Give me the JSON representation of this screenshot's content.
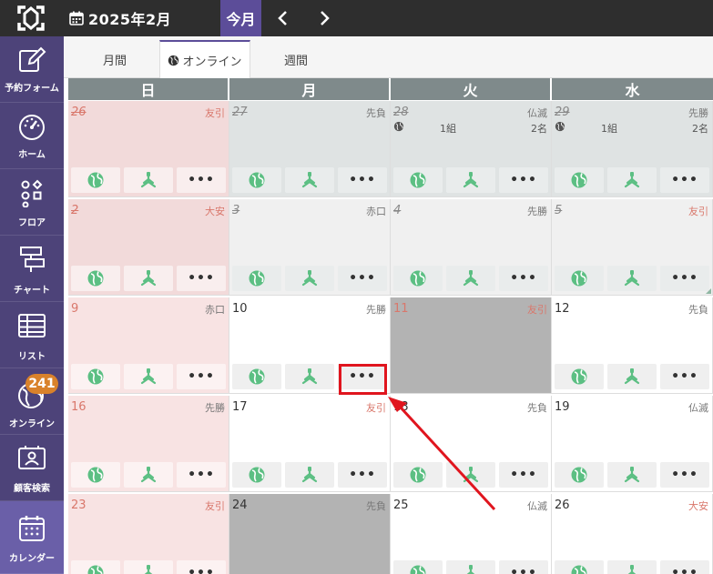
{
  "header": {
    "month": "2025年2月",
    "today_label": "今月"
  },
  "sidebar": {
    "items": [
      {
        "label": "予約フォーム",
        "icon": "edit-icon"
      },
      {
        "label": "ホーム",
        "icon": "dashboard-icon"
      },
      {
        "label": "フロア",
        "icon": "floor-icon"
      },
      {
        "label": "チャート",
        "icon": "chart-icon"
      },
      {
        "label": "リスト",
        "icon": "table-icon"
      },
      {
        "label": "オンライン",
        "icon": "online-globe-icon",
        "badge": "241"
      },
      {
        "label": "顧客検索",
        "icon": "customer-card-icon"
      },
      {
        "label": "カレンダー",
        "icon": "calendar-icon",
        "active": true
      }
    ]
  },
  "tabs": [
    {
      "label": "月間"
    },
    {
      "label": "オンライン",
      "active": true
    },
    {
      "label": "週間"
    }
  ],
  "days": [
    "日",
    "月",
    "火",
    "水"
  ],
  "weeks": [
    [
      {
        "day": "26",
        "rokuyo": "友引"
      },
      {
        "day": "27",
        "rokuyo": "先負"
      },
      {
        "day": "28",
        "rokuyo": "仏滅",
        "groups": "1組",
        "people": "2名"
      },
      {
        "day": "29",
        "rokuyo": "先勝",
        "groups": "1組",
        "people": "2名"
      }
    ],
    [
      {
        "day": "2",
        "rokuyo": "大安"
      },
      {
        "day": "3",
        "rokuyo": "赤口"
      },
      {
        "day": "4",
        "rokuyo": "先勝"
      },
      {
        "day": "5",
        "rokuyo": "友引"
      }
    ],
    [
      {
        "day": "9",
        "rokuyo": "赤口"
      },
      {
        "day": "10",
        "rokuyo": "先勝"
      },
      {
        "day": "11",
        "rokuyo": "友引"
      },
      {
        "day": "12",
        "rokuyo": "先負"
      }
    ],
    [
      {
        "day": "16",
        "rokuyo": "先勝"
      },
      {
        "day": "17",
        "rokuyo": "友引"
      },
      {
        "day": "18",
        "rokuyo": "先負"
      },
      {
        "day": "19",
        "rokuyo": "仏滅"
      }
    ],
    [
      {
        "day": "23",
        "rokuyo": "友引"
      },
      {
        "day": "24",
        "rokuyo": "先負"
      },
      {
        "day": "25",
        "rokuyo": "仏滅"
      },
      {
        "day": "26",
        "rokuyo": "大安"
      }
    ]
  ],
  "colors": {
    "accent": "#5c4d99",
    "sidebar": "#4d4379",
    "button_green": "#5cbf83",
    "highlight": "#e0151e"
  }
}
